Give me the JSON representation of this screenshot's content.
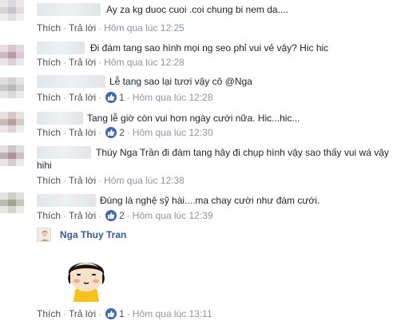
{
  "actions": {
    "like": "Thích",
    "reply": "Trả lời",
    "separator": "·"
  },
  "comments": [
    {
      "text": "Ay za kg duoc cuoi .coi chung bi nem da....",
      "time": "Hôm qua lúc 12:25",
      "likes": null
    },
    {
      "text": "Đi đám tang sao hình mọi ng seo phỉ vui vẻ vậy? Hic hic",
      "time": "Hôm qua lúc 12:28",
      "likes": null
    },
    {
      "text": "Lễ tang sao lại tươi vậy cô @Nga",
      "time": "Hôm qua lúc 12:28",
      "likes": "1"
    },
    {
      "text": "Tang lễ giờ còn vui hơn ngày cưới nữa. Hic...hic...",
      "time": "Hôm qua lúc 12:30",
      "likes": "2"
    },
    {
      "text": "Thúy Nga Trần đi đám tang hây đi chụp hình vậy sao thấy vui wá vậy",
      "text2": "hihi",
      "time": "Hôm qua lúc 12:38",
      "likes": null
    },
    {
      "text": "Đúng là nghệ sỹ hài....ma chay cười như đám cưới.",
      "time": "Hôm qua lúc 12:39",
      "likes": "2"
    }
  ],
  "reply": {
    "author": "Nga Thuy Tran",
    "time": "Hôm qua lúc 13:11",
    "likes": "1"
  },
  "colors": {
    "link": "#365899",
    "meta": "#90949c",
    "like_badge": "#4267b2"
  }
}
